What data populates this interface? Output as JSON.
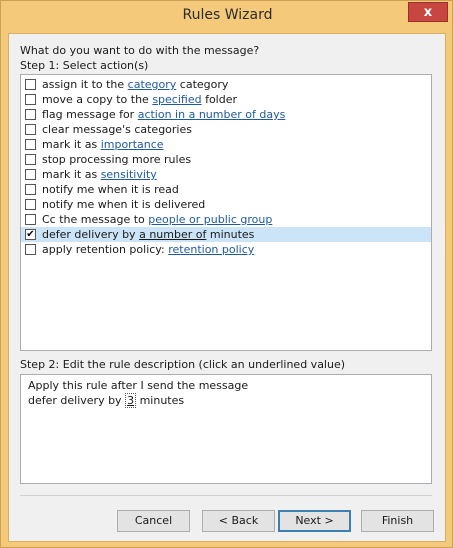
{
  "window": {
    "title": "Rules Wizard",
    "close_glyph": "x"
  },
  "prompt": "What do you want to do with the message?",
  "step1": {
    "label": "Step 1: Select action(s)",
    "actions": [
      {
        "checked": false,
        "pre": "assign it to the ",
        "link": "category",
        "post": " category",
        "selected": false
      },
      {
        "checked": false,
        "pre": "move a copy to the ",
        "link": "specified",
        "post": " folder",
        "selected": false
      },
      {
        "checked": false,
        "pre": "flag message for ",
        "link": "action in a number of days",
        "post": "",
        "selected": false
      },
      {
        "checked": false,
        "pre": "clear message's categories",
        "link": "",
        "post": "",
        "selected": false
      },
      {
        "checked": false,
        "pre": "mark it as ",
        "link": "importance",
        "post": "",
        "selected": false
      },
      {
        "checked": false,
        "pre": "stop processing more rules",
        "link": "",
        "post": "",
        "selected": false
      },
      {
        "checked": false,
        "pre": "mark it as ",
        "link": "sensitivity",
        "post": "",
        "selected": false
      },
      {
        "checked": false,
        "pre": "notify me when it is read",
        "link": "",
        "post": "",
        "selected": false
      },
      {
        "checked": false,
        "pre": "notify me when it is delivered",
        "link": "",
        "post": "",
        "selected": false
      },
      {
        "checked": false,
        "pre": "Cc the message to ",
        "link": "people or public group",
        "post": "",
        "selected": false
      },
      {
        "checked": true,
        "pre": "defer delivery by ",
        "link": "a number of",
        "post": " minutes",
        "selected": true
      },
      {
        "checked": false,
        "pre": "apply retention policy: ",
        "link": "retention policy",
        "post": "",
        "selected": false
      }
    ]
  },
  "step2": {
    "label": "Step 2: Edit the rule description (click an underlined value)",
    "line1": "Apply this rule after I send the message",
    "line2_pre": "defer delivery by ",
    "line2_value": "3",
    "line2_post": " minutes"
  },
  "buttons": {
    "cancel": "Cancel",
    "back": "< Back",
    "next": "Next >",
    "finish": "Finish"
  },
  "colors": {
    "link": "#1f5aa0",
    "selection": "#cce4f7",
    "titlebar": "#f5c97a",
    "close": "#c7463f"
  }
}
